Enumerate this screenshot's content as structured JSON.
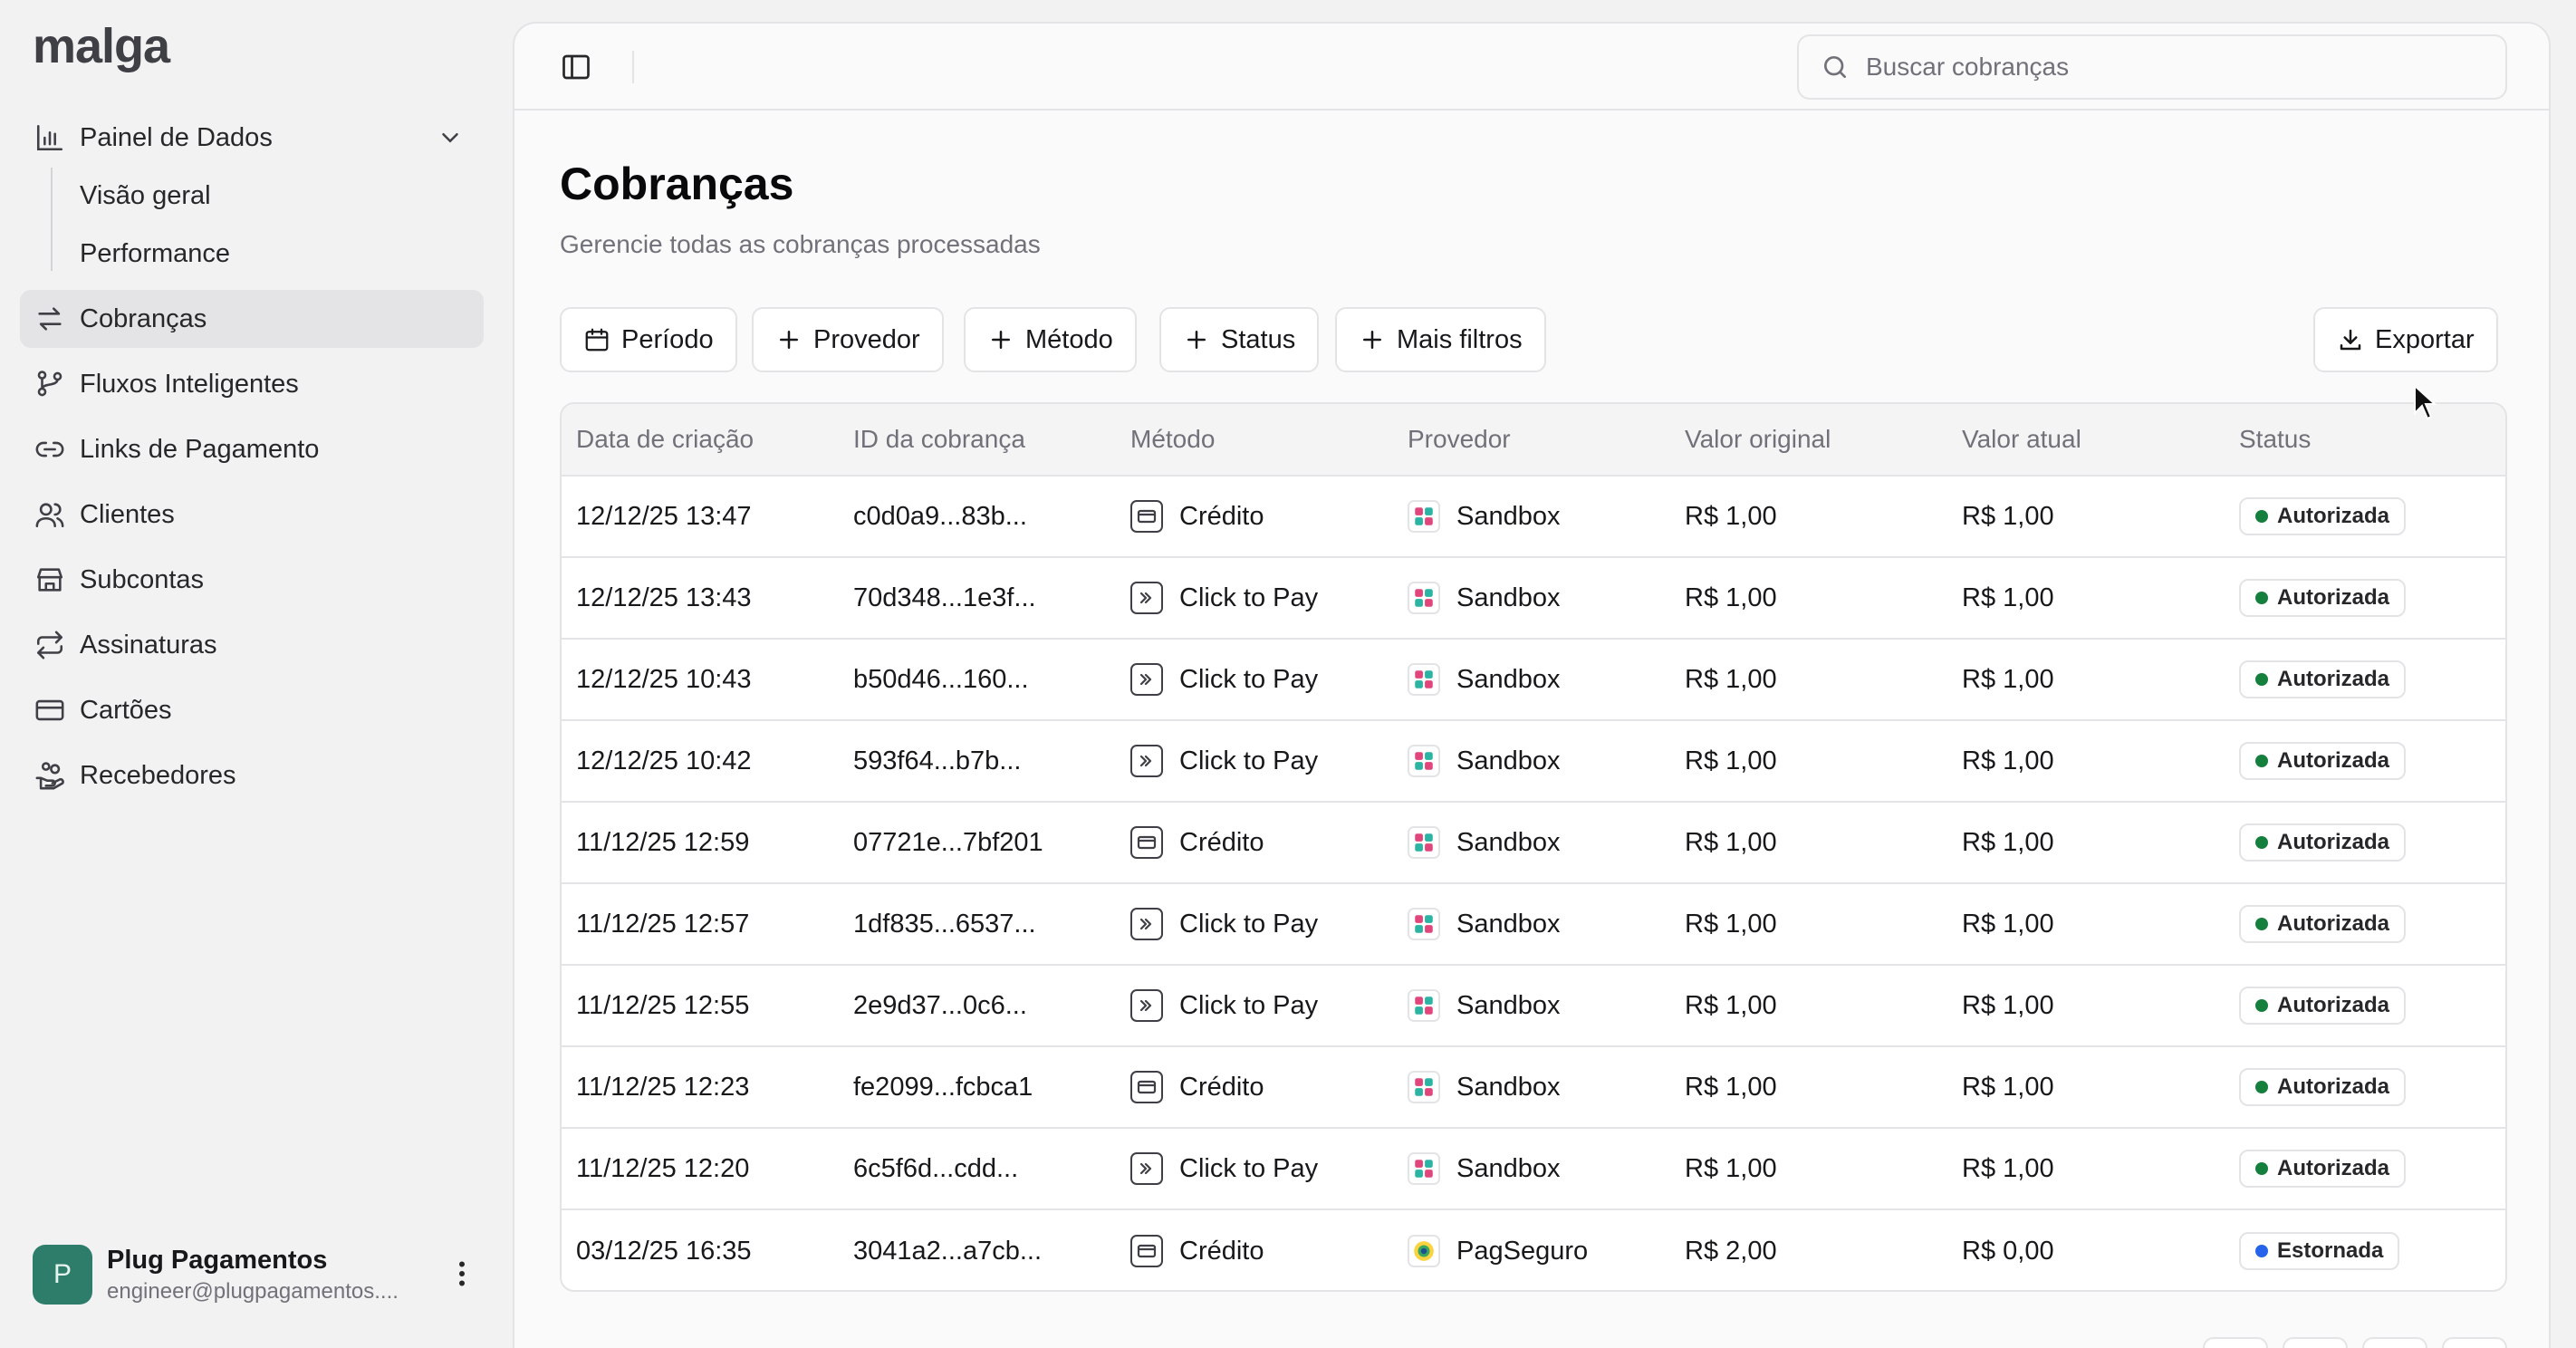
{
  "brand": "malga",
  "sidebar": {
    "dashboard": {
      "label": "Painel de Dados",
      "icon": "bar-chart-icon",
      "children": [
        {
          "label": "Visão geral"
        },
        {
          "label": "Performance"
        }
      ]
    },
    "items": [
      {
        "label": "Cobranças",
        "icon": "arrows-swap-icon",
        "active": true
      },
      {
        "label": "Fluxos Inteligentes",
        "icon": "branch-icon"
      },
      {
        "label": "Links de Pagamento",
        "icon": "link-icon"
      },
      {
        "label": "Clientes",
        "icon": "users-icon"
      },
      {
        "label": "Subcontas",
        "icon": "store-icon"
      },
      {
        "label": "Assinaturas",
        "icon": "repeat-icon"
      },
      {
        "label": "Cartões",
        "icon": "card-icon"
      },
      {
        "label": "Recebedores",
        "icon": "hand-coins-icon"
      }
    ],
    "user": {
      "initial": "P",
      "name": "Plug Pagamentos",
      "email": "engineer@plugpagamentos...."
    }
  },
  "topbar": {
    "search_placeholder": "Buscar cobranças"
  },
  "page": {
    "title": "Cobranças",
    "subtitle": "Gerencie todas as cobranças processadas"
  },
  "filters": {
    "period": "Período",
    "provider": "Provedor",
    "method": "Método",
    "status": "Status",
    "more": "Mais filtros",
    "export": "Exportar"
  },
  "table": {
    "columns": [
      "Data de criação",
      "ID da cobrança",
      "Método",
      "Provedor",
      "Valor original",
      "Valor atual",
      "Status"
    ],
    "rows": [
      {
        "date": "12/12/25 13:47",
        "id": "c0d0a9...83b...",
        "method": "Crédito",
        "method_icon": "credit-card-icon",
        "provider": "Sandbox",
        "original": "R$ 1,00",
        "current": "R$ 1,00",
        "status": "Autorizada",
        "status_color": "#15803d"
      },
      {
        "date": "12/12/25 13:43",
        "id": "70d348...1e3f...",
        "method": "Click to Pay",
        "method_icon": "click-to-pay-icon",
        "provider": "Sandbox",
        "original": "R$ 1,00",
        "current": "R$ 1,00",
        "status": "Autorizada",
        "status_color": "#15803d"
      },
      {
        "date": "12/12/25 10:43",
        "id": "b50d46...160...",
        "method": "Click to Pay",
        "method_icon": "click-to-pay-icon",
        "provider": "Sandbox",
        "original": "R$ 1,00",
        "current": "R$ 1,00",
        "status": "Autorizada",
        "status_color": "#15803d"
      },
      {
        "date": "12/12/25 10:42",
        "id": "593f64...b7b...",
        "method": "Click to Pay",
        "method_icon": "click-to-pay-icon",
        "provider": "Sandbox",
        "original": "R$ 1,00",
        "current": "R$ 1,00",
        "status": "Autorizada",
        "status_color": "#15803d"
      },
      {
        "date": "11/12/25 12:59",
        "id": "07721e...7bf201",
        "method": "Crédito",
        "method_icon": "credit-card-icon",
        "provider": "Sandbox",
        "original": "R$ 1,00",
        "current": "R$ 1,00",
        "status": "Autorizada",
        "status_color": "#15803d"
      },
      {
        "date": "11/12/25 12:57",
        "id": "1df835...6537...",
        "method": "Click to Pay",
        "method_icon": "click-to-pay-icon",
        "provider": "Sandbox",
        "original": "R$ 1,00",
        "current": "R$ 1,00",
        "status": "Autorizada",
        "status_color": "#15803d"
      },
      {
        "date": "11/12/25 12:55",
        "id": "2e9d37...0c6...",
        "method": "Click to Pay",
        "method_icon": "click-to-pay-icon",
        "provider": "Sandbox",
        "original": "R$ 1,00",
        "current": "R$ 1,00",
        "status": "Autorizada",
        "status_color": "#15803d"
      },
      {
        "date": "11/12/25 12:23",
        "id": "fe2099...fcbca1",
        "method": "Crédito",
        "method_icon": "credit-card-icon",
        "provider": "Sandbox",
        "original": "R$ 1,00",
        "current": "R$ 1,00",
        "status": "Autorizada",
        "status_color": "#15803d"
      },
      {
        "date": "11/12/25 12:20",
        "id": "6c5f6d...cdd...",
        "method": "Click to Pay",
        "method_icon": "click-to-pay-icon",
        "provider": "Sandbox",
        "original": "R$ 1,00",
        "current": "R$ 1,00",
        "status": "Autorizada",
        "status_color": "#15803d"
      },
      {
        "date": "03/12/25 16:35",
        "id": "3041a2...a7cb...",
        "method": "Crédito",
        "method_icon": "credit-card-icon",
        "provider": "PagSeguro",
        "original": "R$ 2,00",
        "current": "R$ 0,00",
        "status": "Estornada",
        "status_color": "#2563eb"
      }
    ]
  },
  "colors": {
    "active_nav": "#e4e4e7",
    "avatar": "#2e7d6b",
    "authorized": "#15803d",
    "refunded": "#2563eb"
  }
}
